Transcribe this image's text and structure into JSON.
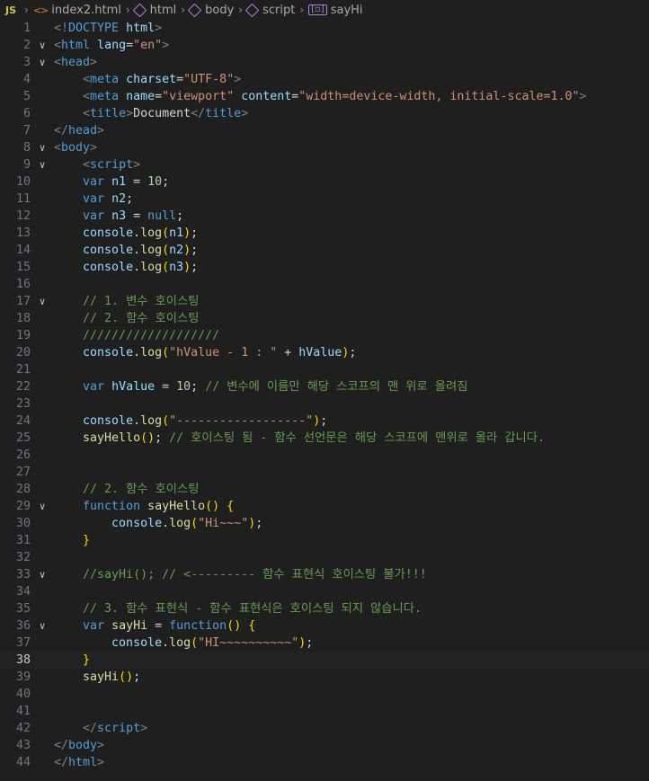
{
  "breadcrumb": {
    "lang_badge": "JS",
    "file": "index2.html",
    "items": [
      "html",
      "body",
      "script",
      "sayHi"
    ]
  },
  "active_line": 38,
  "lines": [
    [
      [
        "br",
        "<!"
      ],
      [
        "tag",
        "DOCTYPE"
      ],
      [
        "txt",
        " "
      ],
      [
        "attr",
        "html"
      ],
      [
        "br",
        ">"
      ]
    ],
    [
      [
        "br",
        "<"
      ],
      [
        "tag",
        "html"
      ],
      [
        "txt",
        " "
      ],
      [
        "attr",
        "lang"
      ],
      [
        "txt",
        "="
      ],
      [
        "str",
        "\"en\""
      ],
      [
        "br",
        ">"
      ]
    ],
    [
      [
        "br",
        "<"
      ],
      [
        "tag",
        "head"
      ],
      [
        "br",
        ">"
      ]
    ],
    [
      [
        "txt",
        "    "
      ],
      [
        "br",
        "<"
      ],
      [
        "tag",
        "meta"
      ],
      [
        "txt",
        " "
      ],
      [
        "attr",
        "charset"
      ],
      [
        "txt",
        "="
      ],
      [
        "str",
        "\"UTF-8\""
      ],
      [
        "br",
        ">"
      ]
    ],
    [
      [
        "txt",
        "    "
      ],
      [
        "br",
        "<"
      ],
      [
        "tag",
        "meta"
      ],
      [
        "txt",
        " "
      ],
      [
        "attr",
        "name"
      ],
      [
        "txt",
        "="
      ],
      [
        "str",
        "\"viewport\""
      ],
      [
        "txt",
        " "
      ],
      [
        "attr",
        "content"
      ],
      [
        "txt",
        "="
      ],
      [
        "str",
        "\"width=device-width, initial-scale=1.0\""
      ],
      [
        "br",
        ">"
      ]
    ],
    [
      [
        "txt",
        "    "
      ],
      [
        "br",
        "<"
      ],
      [
        "tag",
        "title"
      ],
      [
        "br",
        ">"
      ],
      [
        "txt",
        "Document"
      ],
      [
        "br",
        "</"
      ],
      [
        "tag",
        "title"
      ],
      [
        "br",
        ">"
      ]
    ],
    [
      [
        "br",
        "</"
      ],
      [
        "tag",
        "head"
      ],
      [
        "br",
        ">"
      ]
    ],
    [
      [
        "br",
        "<"
      ],
      [
        "tag",
        "body"
      ],
      [
        "br",
        ">"
      ]
    ],
    [
      [
        "txt",
        "    "
      ],
      [
        "br",
        "<"
      ],
      [
        "tag",
        "script"
      ],
      [
        "br",
        ">"
      ]
    ],
    [
      [
        "txt",
        "    "
      ],
      [
        "kw",
        "var"
      ],
      [
        "txt",
        " "
      ],
      [
        "var",
        "n1"
      ],
      [
        "txt",
        " = "
      ],
      [
        "num",
        "10"
      ],
      [
        "txt",
        ";"
      ]
    ],
    [
      [
        "txt",
        "    "
      ],
      [
        "kw",
        "var"
      ],
      [
        "txt",
        " "
      ],
      [
        "var",
        "n2"
      ],
      [
        "txt",
        ";"
      ]
    ],
    [
      [
        "txt",
        "    "
      ],
      [
        "kw",
        "var"
      ],
      [
        "txt",
        " "
      ],
      [
        "var",
        "n3"
      ],
      [
        "txt",
        " = "
      ],
      [
        "kw",
        "null"
      ],
      [
        "txt",
        ";"
      ]
    ],
    [
      [
        "txt",
        "    "
      ],
      [
        "var",
        "console"
      ],
      [
        "txt",
        "."
      ],
      [
        "fn",
        "log"
      ],
      [
        "p",
        "("
      ],
      [
        "var",
        "n1"
      ],
      [
        "p",
        ")"
      ],
      [
        "txt",
        ";"
      ]
    ],
    [
      [
        "txt",
        "    "
      ],
      [
        "var",
        "console"
      ],
      [
        "txt",
        "."
      ],
      [
        "fn",
        "log"
      ],
      [
        "p",
        "("
      ],
      [
        "var",
        "n2"
      ],
      [
        "p",
        ")"
      ],
      [
        "txt",
        ";"
      ]
    ],
    [
      [
        "txt",
        "    "
      ],
      [
        "var",
        "console"
      ],
      [
        "txt",
        "."
      ],
      [
        "fn",
        "log"
      ],
      [
        "p",
        "("
      ],
      [
        "var",
        "n3"
      ],
      [
        "p",
        ")"
      ],
      [
        "txt",
        ";"
      ]
    ],
    [
      [
        "txt",
        ""
      ]
    ],
    [
      [
        "txt",
        "    "
      ],
      [
        "cm",
        "// 1. 변수 호이스팅"
      ]
    ],
    [
      [
        "txt",
        "    "
      ],
      [
        "cm",
        "// 2. 함수 호이스팅"
      ]
    ],
    [
      [
        "txt",
        "    "
      ],
      [
        "cm",
        "///////////////////"
      ]
    ],
    [
      [
        "txt",
        "    "
      ],
      [
        "var",
        "console"
      ],
      [
        "txt",
        "."
      ],
      [
        "fn",
        "log"
      ],
      [
        "p",
        "("
      ],
      [
        "str",
        "\"hValue - 1 : \""
      ],
      [
        "txt",
        " + "
      ],
      [
        "var",
        "hValue"
      ],
      [
        "p",
        ")"
      ],
      [
        "txt",
        ";"
      ]
    ],
    [
      [
        "txt",
        ""
      ]
    ],
    [
      [
        "txt",
        "    "
      ],
      [
        "kw",
        "var"
      ],
      [
        "txt",
        " "
      ],
      [
        "var",
        "hValue"
      ],
      [
        "txt",
        " = "
      ],
      [
        "num",
        "10"
      ],
      [
        "txt",
        "; "
      ],
      [
        "cm",
        "// 변수에 이름만 해당 스코프의 맨 위로 올려짐"
      ]
    ],
    [
      [
        "txt",
        ""
      ]
    ],
    [
      [
        "txt",
        "    "
      ],
      [
        "var",
        "console"
      ],
      [
        "txt",
        "."
      ],
      [
        "fn",
        "log"
      ],
      [
        "p",
        "("
      ],
      [
        "str",
        "\"------------------\""
      ],
      [
        "p",
        ")"
      ],
      [
        "txt",
        ";"
      ]
    ],
    [
      [
        "txt",
        "    "
      ],
      [
        "fn",
        "sayHello"
      ],
      [
        "p",
        "()"
      ],
      [
        "txt",
        "; "
      ],
      [
        "cm",
        "// 호이스팅 됨 - 함수 선언문은 해당 스코프에 맨위로 올라 갑니다."
      ]
    ],
    [
      [
        "txt",
        ""
      ]
    ],
    [
      [
        "txt",
        ""
      ]
    ],
    [
      [
        "txt",
        "    "
      ],
      [
        "cm",
        "// 2. 함수 호이스팅"
      ]
    ],
    [
      [
        "txt",
        "    "
      ],
      [
        "kw",
        "function"
      ],
      [
        "txt",
        " "
      ],
      [
        "fn",
        "sayHello"
      ],
      [
        "p",
        "()"
      ],
      [
        "txt",
        " "
      ],
      [
        "p",
        "{"
      ]
    ],
    [
      [
        "txt",
        "        "
      ],
      [
        "var",
        "console"
      ],
      [
        "txt",
        "."
      ],
      [
        "fn",
        "log"
      ],
      [
        "p",
        "("
      ],
      [
        "str",
        "\"Hi~~~\""
      ],
      [
        "p",
        ")"
      ],
      [
        "txt",
        ";"
      ]
    ],
    [
      [
        "txt",
        "    "
      ],
      [
        "p",
        "}"
      ]
    ],
    [
      [
        "txt",
        ""
      ]
    ],
    [
      [
        "txt",
        "    "
      ],
      [
        "cm",
        "//sayHi(); // <--------- 함수 표현식 호이스팅 불가!!!"
      ]
    ],
    [
      [
        "txt",
        ""
      ]
    ],
    [
      [
        "txt",
        "    "
      ],
      [
        "cm",
        "// 3. 함수 표현식 - 함수 표현식은 호이스팅 되지 않습니다."
      ]
    ],
    [
      [
        "txt",
        "    "
      ],
      [
        "kw",
        "var"
      ],
      [
        "txt",
        " "
      ],
      [
        "fn",
        "sayHi"
      ],
      [
        "txt",
        " = "
      ],
      [
        "kw",
        "function"
      ],
      [
        "p",
        "()"
      ],
      [
        "txt",
        " "
      ],
      [
        "p",
        "{"
      ]
    ],
    [
      [
        "txt",
        "        "
      ],
      [
        "var",
        "console"
      ],
      [
        "txt",
        "."
      ],
      [
        "fn",
        "log"
      ],
      [
        "p",
        "("
      ],
      [
        "str",
        "\"HI~~~~~~~~~~\""
      ],
      [
        "p",
        ")"
      ],
      [
        "txt",
        ";"
      ]
    ],
    [
      [
        "txt",
        "    "
      ],
      [
        "p",
        "}"
      ]
    ],
    [
      [
        "txt",
        "    "
      ],
      [
        "fn",
        "sayHi"
      ],
      [
        "p",
        "()"
      ],
      [
        "txt",
        ";"
      ]
    ],
    [
      [
        "txt",
        ""
      ]
    ],
    [
      [
        "txt",
        ""
      ]
    ],
    [
      [
        "txt",
        "    "
      ],
      [
        "br",
        "</"
      ],
      [
        "tag",
        "script"
      ],
      [
        "br",
        ">"
      ]
    ],
    [
      [
        "br",
        "</"
      ],
      [
        "tag",
        "body"
      ],
      [
        "br",
        ">"
      ]
    ],
    [
      [
        "br",
        "</"
      ],
      [
        "tag",
        "html"
      ],
      [
        "br",
        ">"
      ]
    ]
  ],
  "fold_lines": [
    2,
    3,
    8,
    9,
    17,
    29,
    33,
    36
  ],
  "colors": {
    "background": "#1f1f1f",
    "keyword": "#569cd6",
    "string": "#ce9178",
    "comment": "#6a9955",
    "function": "#dcdcaa",
    "variable": "#9cdcfe",
    "number": "#b5cea8",
    "bracket": "#ffd700"
  }
}
